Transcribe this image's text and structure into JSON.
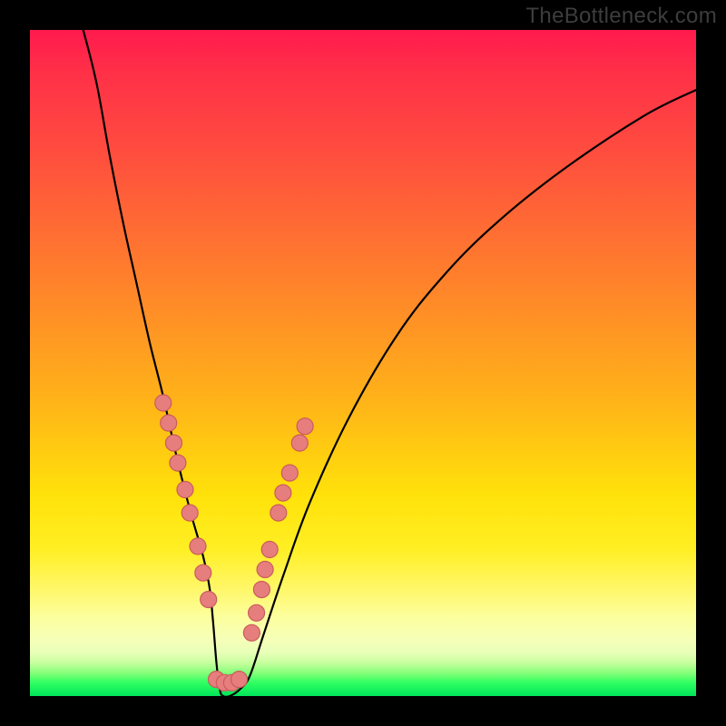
{
  "watermark": "TheBottleneck.com",
  "colors": {
    "frame": "#000000",
    "gradient_top": "#ff1a4d",
    "gradient_mid": "#ffe20a",
    "gradient_bottom": "#00e45a",
    "curve": "#000000",
    "dot_fill": "#e77e7e",
    "dot_stroke": "#c95b5b"
  },
  "chart_data": {
    "type": "line",
    "title": "",
    "xlabel": "",
    "ylabel": "",
    "xlim": [
      0,
      100
    ],
    "ylim": [
      0,
      100
    ],
    "grid": false,
    "legend": false,
    "series": [
      {
        "name": "bottleneck-curve",
        "x": [
          8,
          10,
          12,
          14,
          16,
          18,
          20,
          22,
          24,
          26,
          27,
          27.5,
          28,
          28.5,
          29,
          30,
          31.5,
          33,
          35,
          38,
          42,
          48,
          55,
          62,
          70,
          80,
          92,
          100
        ],
        "y": [
          100,
          92,
          81,
          71,
          62,
          53,
          45,
          36,
          28,
          21,
          16,
          11,
          5,
          1,
          0,
          0,
          1,
          3,
          9,
          18,
          29,
          42,
          54,
          63,
          71,
          79,
          87,
          91
        ]
      }
    ],
    "markers": [
      {
        "x": 20.0,
        "y": 44
      },
      {
        "x": 20.8,
        "y": 41
      },
      {
        "x": 21.6,
        "y": 38
      },
      {
        "x": 22.2,
        "y": 35
      },
      {
        "x": 23.3,
        "y": 31
      },
      {
        "x": 24.0,
        "y": 27.5
      },
      {
        "x": 25.2,
        "y": 22.5
      },
      {
        "x": 26.0,
        "y": 18.5
      },
      {
        "x": 26.8,
        "y": 14.5
      },
      {
        "x": 28.0,
        "y": 2.5
      },
      {
        "x": 29.2,
        "y": 2.0
      },
      {
        "x": 30.3,
        "y": 2.0
      },
      {
        "x": 31.4,
        "y": 2.5
      },
      {
        "x": 33.3,
        "y": 9.5
      },
      {
        "x": 34.0,
        "y": 12.5
      },
      {
        "x": 34.8,
        "y": 16
      },
      {
        "x": 35.3,
        "y": 19
      },
      {
        "x": 36.0,
        "y": 22
      },
      {
        "x": 37.3,
        "y": 27.5
      },
      {
        "x": 38.0,
        "y": 30.5
      },
      {
        "x": 39.0,
        "y": 33.5
      },
      {
        "x": 40.5,
        "y": 38
      },
      {
        "x": 41.3,
        "y": 40.5
      }
    ],
    "marker_radius_px": 9
  }
}
